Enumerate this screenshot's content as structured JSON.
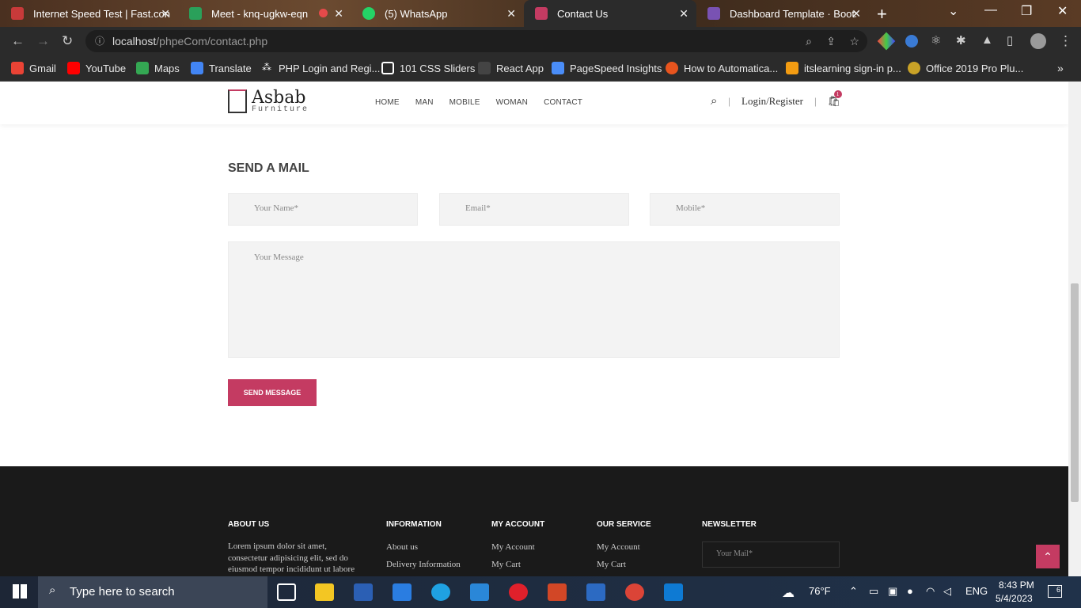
{
  "browser": {
    "tabs": [
      {
        "label": "Internet Speed Test | Fast.con",
        "color": "#c83a3a"
      },
      {
        "label": "Meet - knq-ugkw-eqn",
        "color": "#2aa05a"
      },
      {
        "label": "(5) WhatsApp",
        "color": "#25d366"
      },
      {
        "label": "Contact Us",
        "color": "#c43b62"
      },
      {
        "label": "Dashboard Template · Bootst",
        "color": "#7952b3"
      }
    ],
    "active_tab": "Contact Us",
    "url_host": "localhost",
    "url_path": "/phpeCom/contact.php",
    "bookmarks": [
      "Gmail",
      "YouTube",
      "Maps",
      "Translate",
      "PHP Login and Regi...",
      "101 CSS Sliders",
      "React App",
      "PageSpeed Insights",
      "How to Automatica...",
      "itslearning sign-in p...",
      "Office 2019 Pro Plu..."
    ]
  },
  "site": {
    "logo_name": "Asbab",
    "logo_sub": "Furniture",
    "nav": [
      "HOME",
      "MAN",
      "MOBILE",
      "WOMAN",
      "CONTACT"
    ],
    "login_label": "Login/Register",
    "cart_count": "1",
    "accent": "#c43b62"
  },
  "contact": {
    "title": "SEND A MAIL",
    "name_placeholder": "Your Name*",
    "email_placeholder": "Email*",
    "mobile_placeholder": "Mobile*",
    "message_placeholder": "Your Message",
    "send_label": "SEND MESSAGE"
  },
  "footer": {
    "about_title": "ABOUT US",
    "about_text": "Lorem ipsum dolor sit amet, consectetur adipisicing elit, sed do eiusmod tempor incididunt ut labore",
    "info_title": "INFORMATION",
    "info_links": [
      "About us",
      "Delivery Information"
    ],
    "account_title": "MY ACCOUNT",
    "account_links": [
      "My Account",
      "My Cart"
    ],
    "service_title": "OUR SERVICE",
    "service_links": [
      "My Account",
      "My Cart"
    ],
    "newsletter_title": "NEWSLETTER",
    "newsletter_placeholder": "Your Mail*"
  },
  "taskbar": {
    "search_placeholder": "Type here to search",
    "weather": "76°F",
    "lang": "ENG",
    "time": "8:43 PM",
    "date": "5/4/2023",
    "notifications": "6"
  }
}
